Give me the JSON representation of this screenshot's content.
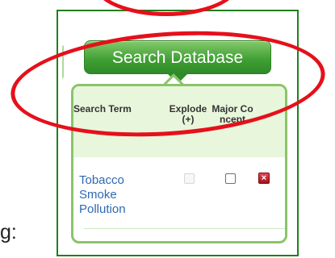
{
  "panel": {
    "button_label": "Search Database",
    "headers": {
      "search_term": "Search Term",
      "explode": "Explode\n(+)",
      "major_concept": "Major Co\nncept"
    },
    "rows": [
      {
        "search_term": "Tobacco\nSmoke\nPollution",
        "explode_checked": false,
        "explode_disabled": true,
        "major_concept_checked": false,
        "delete_icon": "x-icon"
      }
    ]
  },
  "page": {
    "outside_text": "g:"
  },
  "annotations": {
    "highlight_color": "#e5101b"
  }
}
